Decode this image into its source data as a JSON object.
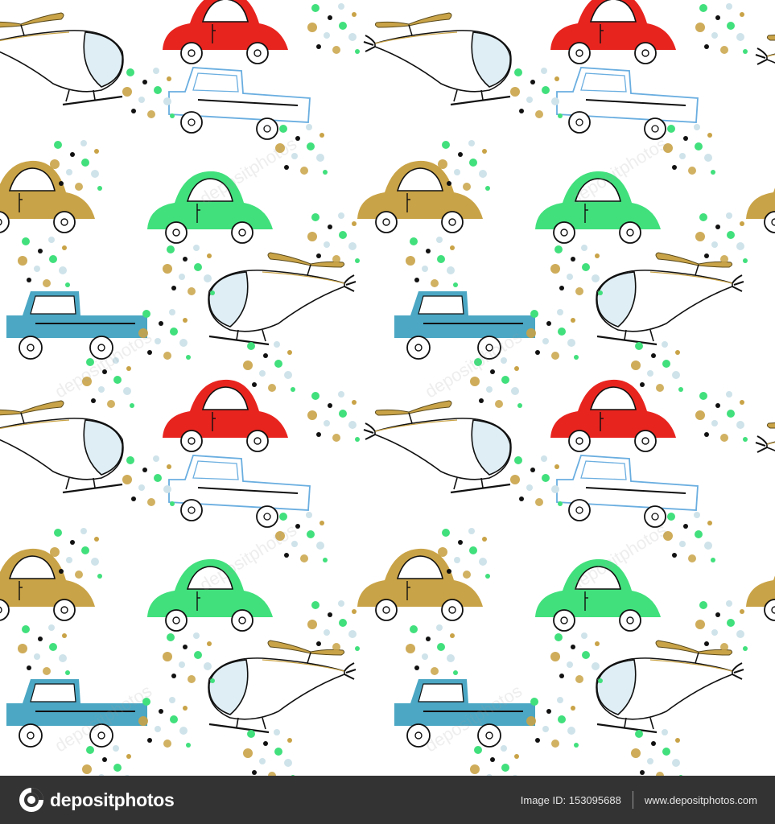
{
  "footer": {
    "logo_text": "depositphotos",
    "image_id_text": "Image ID: 153095688",
    "website": "www.depositphotos.com"
  },
  "watermark_text": "depositphotos",
  "icons": {
    "logo": "camera-aperture-icon"
  },
  "colors": {
    "red_car": "#e8241f",
    "gold_car": "#c9a347",
    "green_car": "#41e07d",
    "blue_truck": "#4ba7c4",
    "outline_truck": "#6aaee0",
    "heli_glass": "#dfeef4",
    "footer_bg": "#333333"
  }
}
